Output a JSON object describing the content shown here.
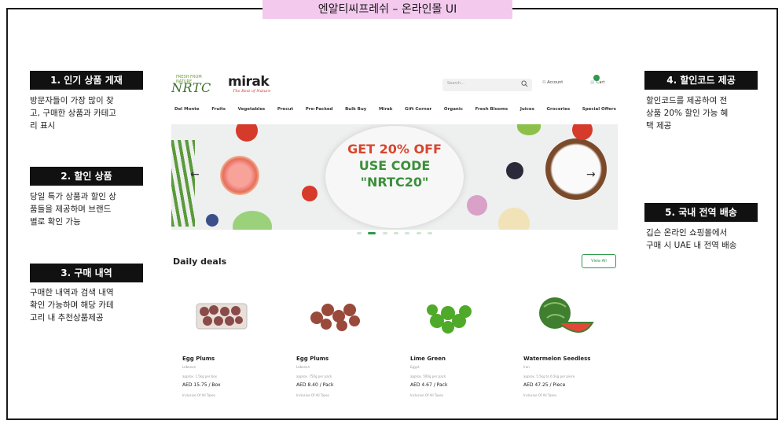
{
  "title": "엔알티씨프레쉬 – 온라인몰 UI",
  "annotations": [
    {
      "heading": "1. 인기 상품 게재",
      "body": [
        "방문자들이 가장 많이 찾",
        "고, 구매한 상품과 카테고",
        "리 표시"
      ]
    },
    {
      "heading": "2. 할인 상품",
      "body": [
        "당일 특가 상품과 할인 상",
        "품들을 제공하며 브랜드",
        "별로 확인 가능"
      ]
    },
    {
      "heading": "3. 구매 내역",
      "body": [
        "구매한 내역과 검색 내역",
        "확인 가능하며 해당 카테",
        "고리 내 추천상품제공"
      ]
    },
    {
      "heading": "4. 할인코드 제공",
      "body": [
        "할인코드를 제공하여 전",
        "상품 20% 할인 가능 혜",
        "택 제공"
      ]
    },
    {
      "heading": "5. 국내 전역 배송",
      "body": [
        "깁슨 온라인 쇼핑몰에서",
        "구매 시 UAE 내 전역 배송"
      ]
    }
  ],
  "site": {
    "brand1_small": "FRESH FROM NATURE",
    "brand1": "NRTC",
    "brand2": "mirak",
    "brand2_tag": "The Best of Nature",
    "search_placeholder": "Search...",
    "account_label": "Account",
    "cart_label": "Cart",
    "nav": [
      "Del Monte",
      "Fruits",
      "Vegetables",
      "Precut",
      "Pre-Packed",
      "Bulk Buy",
      "Mirak",
      "Gift Corner",
      "Organic",
      "Fresh Blooms",
      "Juices",
      "Groceries",
      "Special Offers"
    ],
    "banner": {
      "line1": "GET 20% OFF",
      "line2": "USE CODE",
      "line3": "\"NRTC20\""
    },
    "deals_title": "Daily deals",
    "view_all": "View All",
    "products": [
      {
        "name": "Egg Plums",
        "origin": "Lebanon",
        "weight": "approx. 1.5kg per box",
        "price": "AED 15.75 / Box",
        "tax": "Inclusive Of All Taxes"
      },
      {
        "name": "Egg Plums",
        "origin": "Lebanon",
        "weight": "approx. 750g per pack",
        "price": "AED 8.40 / Pack",
        "tax": "Inclusive Of All Taxes"
      },
      {
        "name": "Lime Green",
        "origin": "Egypt",
        "weight": "approx. 500g per pack",
        "price": "AED 4.67 / Pack",
        "tax": "Inclusive Of All Taxes"
      },
      {
        "name": "Watermelon Seedless",
        "origin": "Iran",
        "weight": "approx. 5.5kg to 6.5kg per piece",
        "price": "AED 47.25 / Piece",
        "tax": "Inclusive Of All Taxes"
      }
    ]
  },
  "colors": {
    "accent_green": "#2e9a4a",
    "promo_red": "#d6462f",
    "title_pink": "#f4c9ee"
  }
}
